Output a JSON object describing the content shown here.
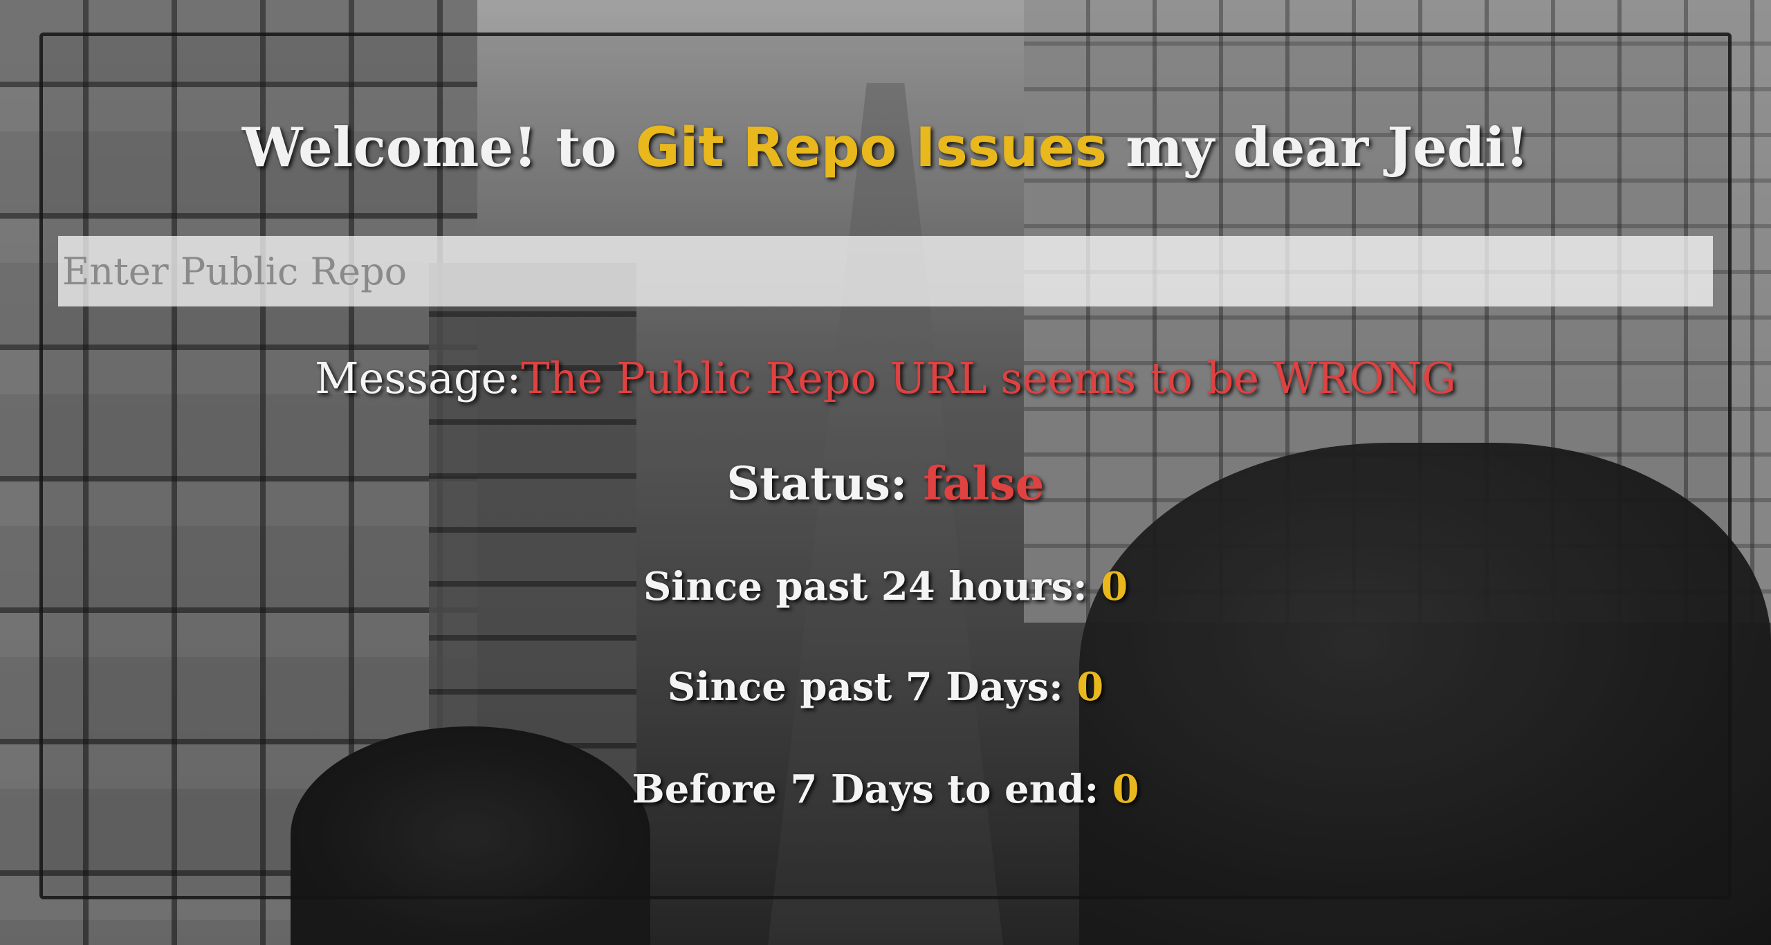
{
  "header": {
    "title_prefix": "Welcome! to ",
    "title_accent": "Git Repo Issues",
    "title_suffix": " my dear Jedi!"
  },
  "search": {
    "placeholder": "Enter Public Repo",
    "value": ""
  },
  "message": {
    "label": "Message:",
    "text": "The Public Repo URL seems to be WRONG"
  },
  "status": {
    "label": "Status: ",
    "value": "false"
  },
  "stats": {
    "past_24h_label": "Since past 24 hours: ",
    "past_24h_value": "0",
    "past_7d_label": "Since past 7 Days: ",
    "past_7d_value": "0",
    "before_7d_label": "Before 7 Days to end: ",
    "before_7d_value": "0"
  },
  "colors": {
    "accent": "#e8b81d",
    "error": "#e04141",
    "text": "#f4f4f4"
  }
}
